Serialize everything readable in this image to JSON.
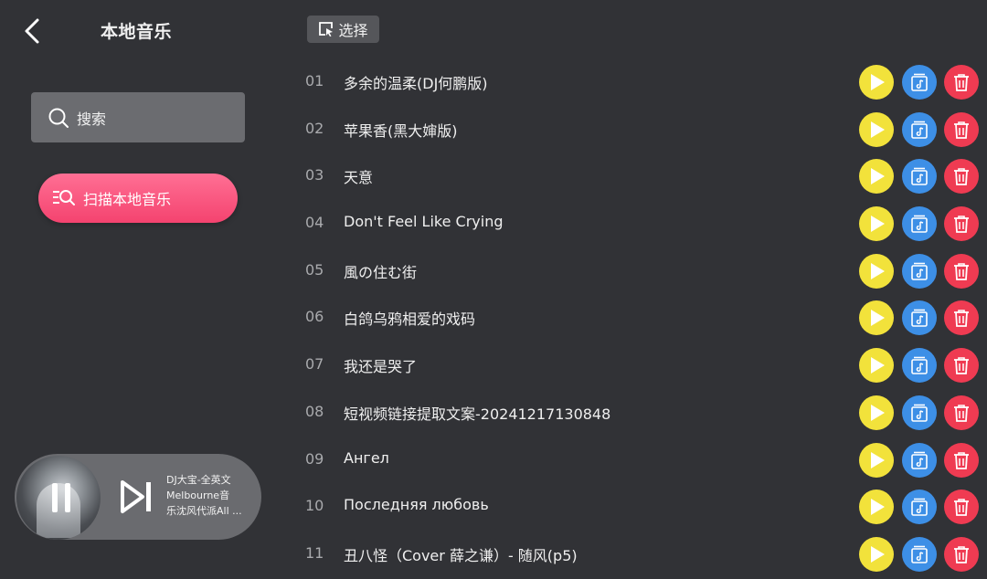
{
  "header": {
    "title": "本地音乐"
  },
  "search": {
    "label": "搜索"
  },
  "scan": {
    "label": "扫描本地音乐"
  },
  "toolbar": {
    "select_label": "选择"
  },
  "songs": [
    {
      "num": "01",
      "name": "多余的温柔(DJ何鹏版)"
    },
    {
      "num": "02",
      "name": "苹果香(黑大婶版)"
    },
    {
      "num": "03",
      "name": "天意"
    },
    {
      "num": "04",
      "name": "Don't Feel Like Crying"
    },
    {
      "num": "05",
      "name": "風の住む街"
    },
    {
      "num": "06",
      "name": "白鸽乌鸦相爱的戏码"
    },
    {
      "num": "07",
      "name": "我还是哭了"
    },
    {
      "num": "08",
      "name": "短视频链接提取文案-20241217130848"
    },
    {
      "num": "09",
      "name": "Ангел"
    },
    {
      "num": "10",
      "name": "Последняя любовь"
    },
    {
      "num": "11",
      "name": "丑八怪（Cover 薛之谦）- 随风(p5)"
    }
  ],
  "player": {
    "line1": "DJ大宝-全英文",
    "line2": "Melbourne音",
    "line3": "乐沈风代派All ..."
  },
  "colors": {
    "play": "#f2e23b",
    "add": "#3d8fe6",
    "delete": "#ef3b52",
    "accent": "#f4436f",
    "background": "#313236"
  },
  "icons": [
    "back-arrow-icon",
    "search-icon",
    "scan-icon",
    "select-icon",
    "play-icon",
    "add-to-playlist-icon",
    "trash-icon",
    "pause-icon",
    "skip-next-icon"
  ]
}
